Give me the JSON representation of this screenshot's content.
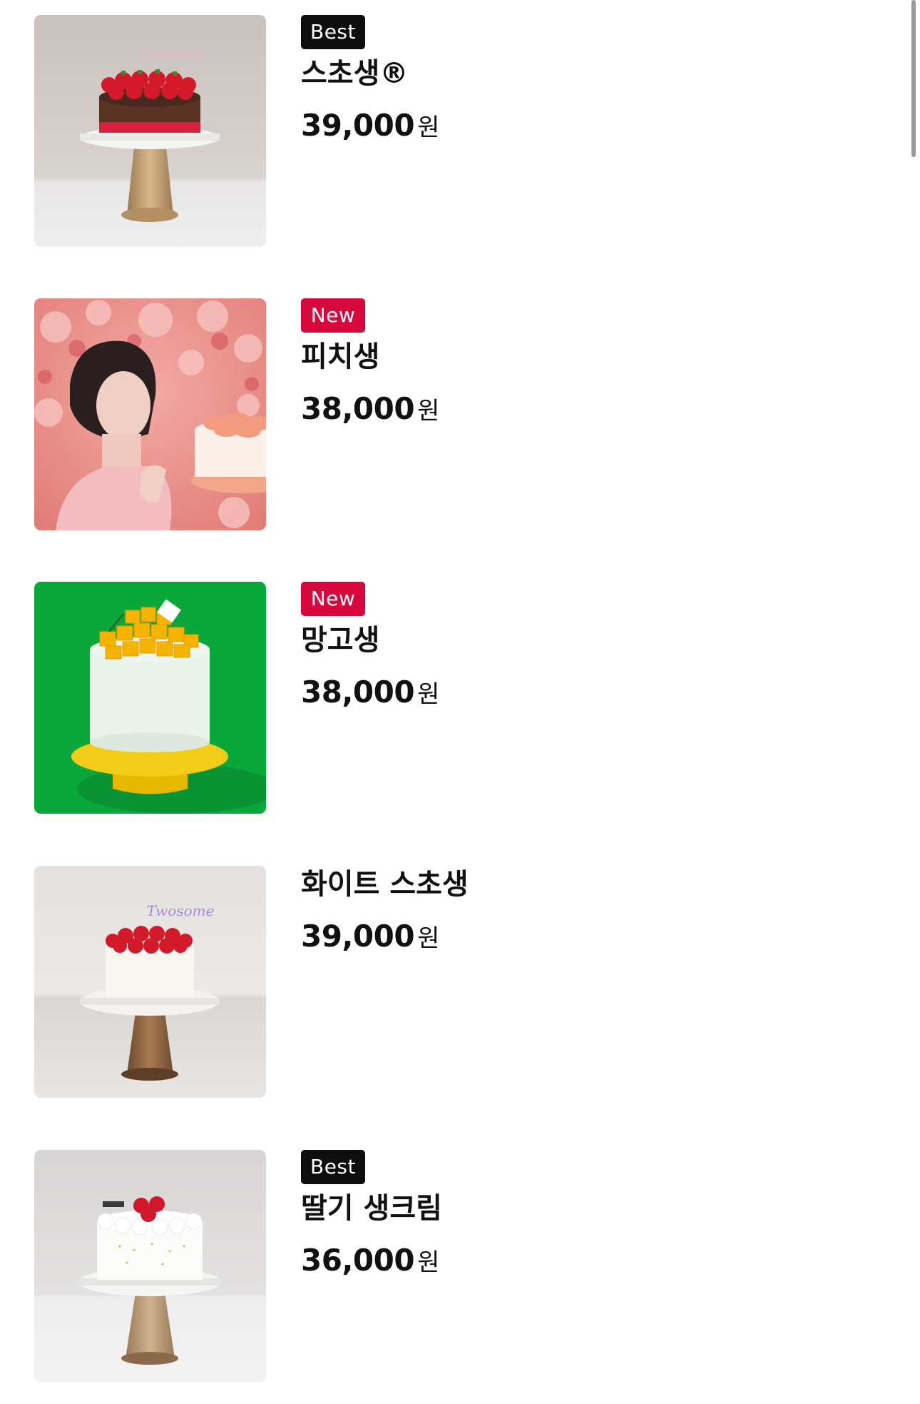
{
  "products": [
    {
      "badge": "Best",
      "badge_type": "best",
      "name": "스초생®",
      "price": "39,000",
      "unit": "원",
      "image": "strawberry-chocolate-cake"
    },
    {
      "badge": "New",
      "badge_type": "new",
      "name": "피치생",
      "price": "38,000",
      "unit": "원",
      "image": "peach-cake-with-model"
    },
    {
      "badge": "New",
      "badge_type": "new",
      "name": "망고생",
      "price": "38,000",
      "unit": "원",
      "image": "mango-cake-green-background"
    },
    {
      "badge": "",
      "badge_type": "none",
      "name": "화이트 스초생",
      "price": "39,000",
      "unit": "원",
      "image": "white-strawberry-cake"
    },
    {
      "badge": "Best",
      "badge_type": "best",
      "name": "딸기 생크림",
      "price": "36,000",
      "unit": "원",
      "image": "strawberry-cream-cake"
    }
  ],
  "image_text": {
    "logo": "Twosome"
  },
  "colors": {
    "badge_best": "#0d0d0d",
    "badge_new": "#d7063b"
  }
}
